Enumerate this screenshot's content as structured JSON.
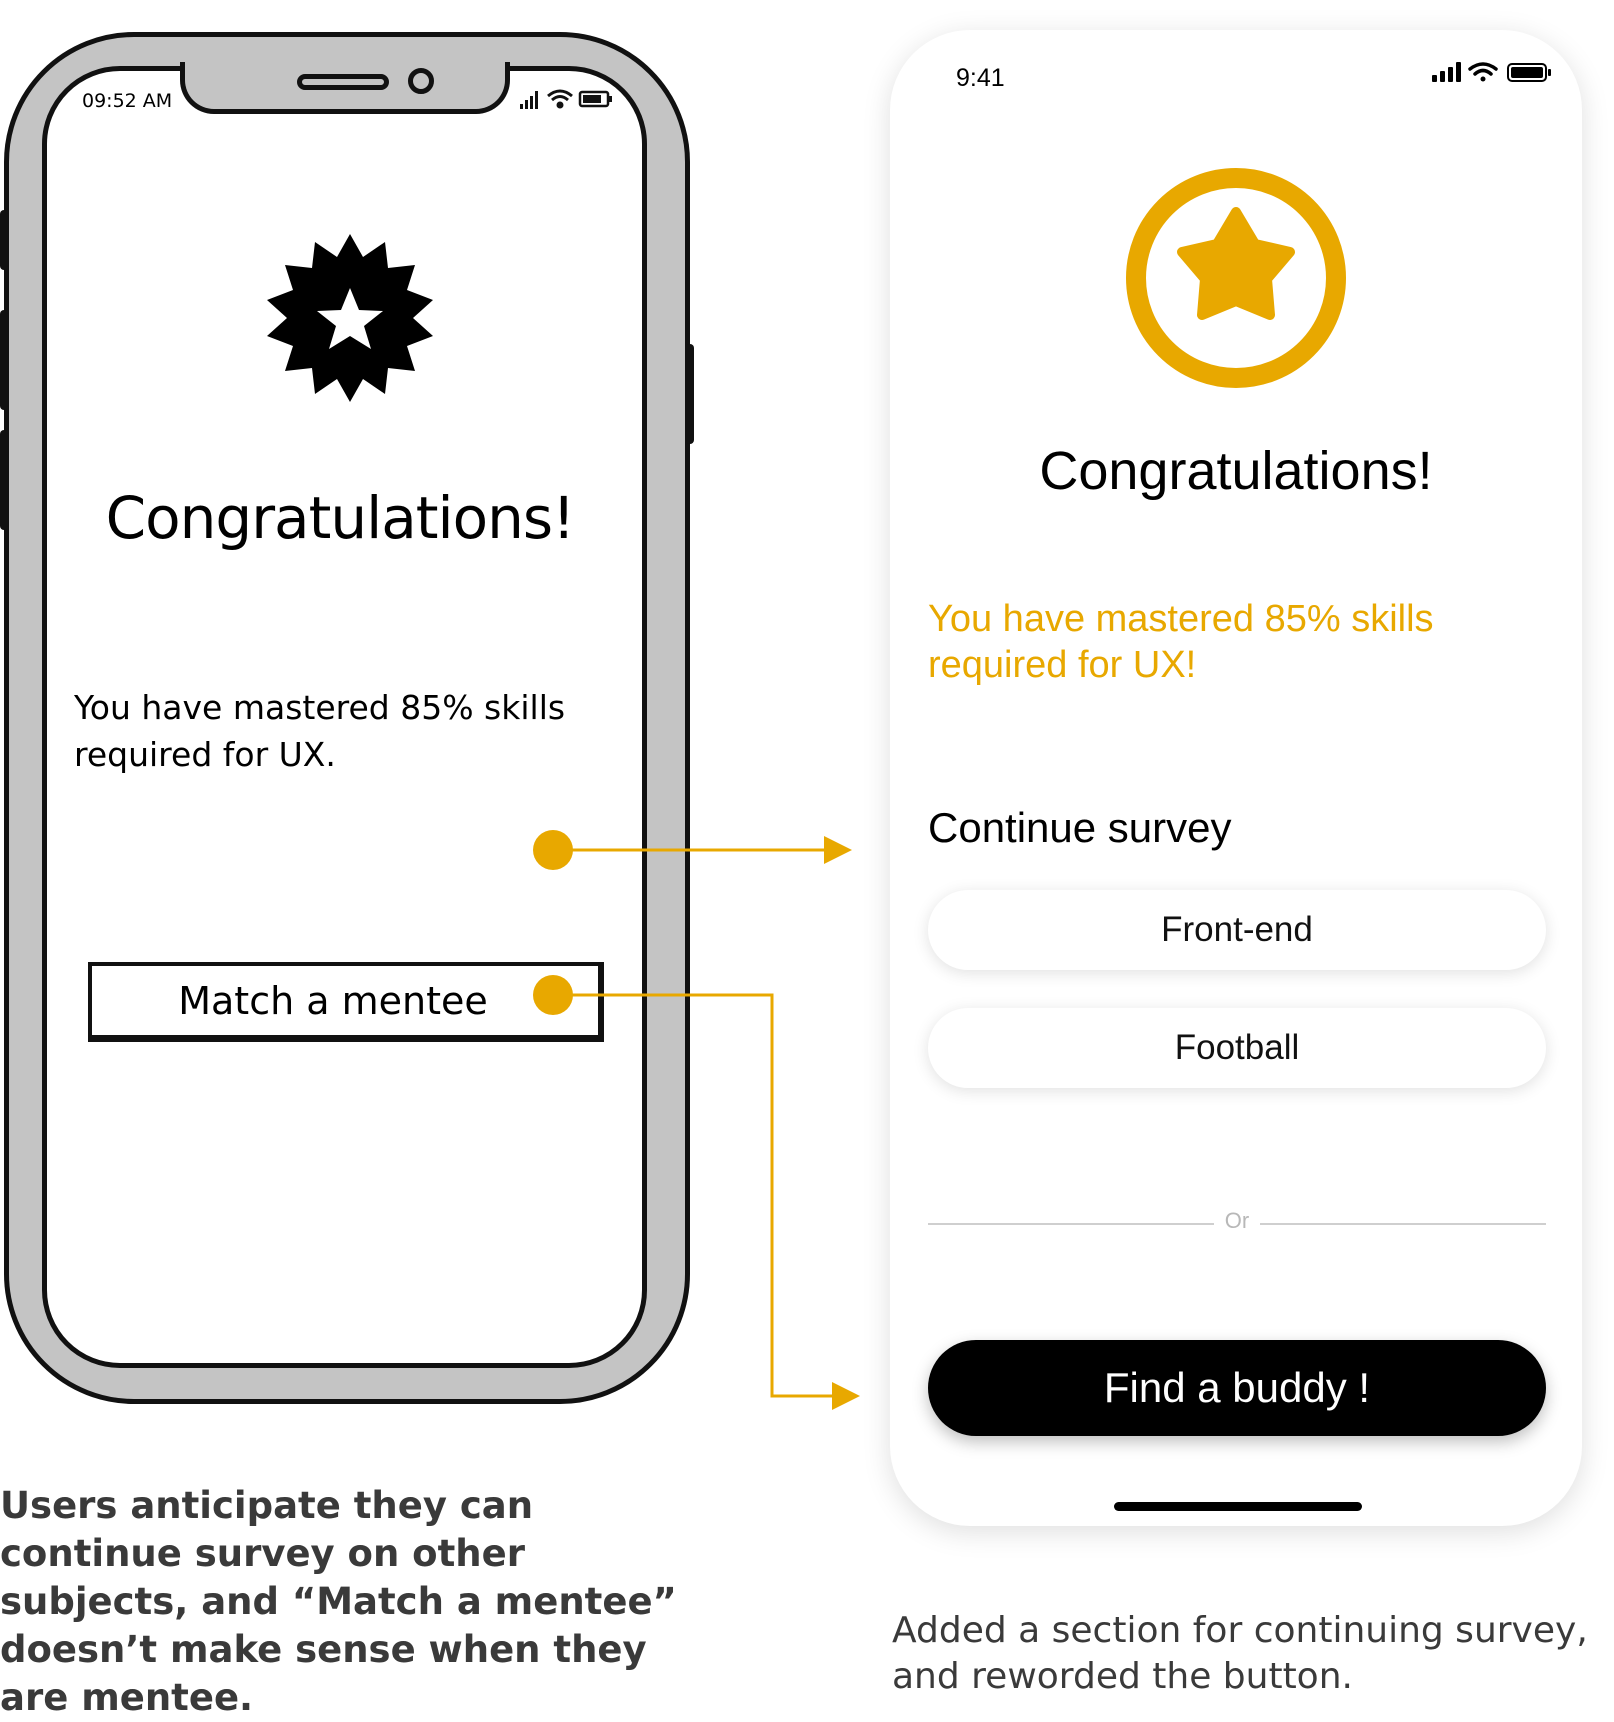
{
  "wireframe": {
    "status_time": "09:52 AM",
    "title": "Congratulations!",
    "body": "You have mastered 85% skills required for UX.",
    "button_label": "Match a mentee",
    "badge_icon": "star-seal-icon"
  },
  "hifi": {
    "status_time": "9:41",
    "title": "Congratulations!",
    "message": "You have mastered 85% skills required for UX!",
    "section_title": "Continue survey",
    "survey_options": [
      "Front-end",
      "Football"
    ],
    "divider_text": "Or",
    "cta_label": "Find a buddy !",
    "badge_icon": "star-circle-icon"
  },
  "captions": {
    "left": "Users anticipate they can continue survey on other subjects, and “Match a mentee” doesn’t make sense when they are mentee.",
    "right": "Added a section for continuing survey, and reworded the button."
  },
  "colors": {
    "accent": "#e8a800",
    "wireframe_frame": "#c4c4c4",
    "cta_background": "#000000"
  }
}
